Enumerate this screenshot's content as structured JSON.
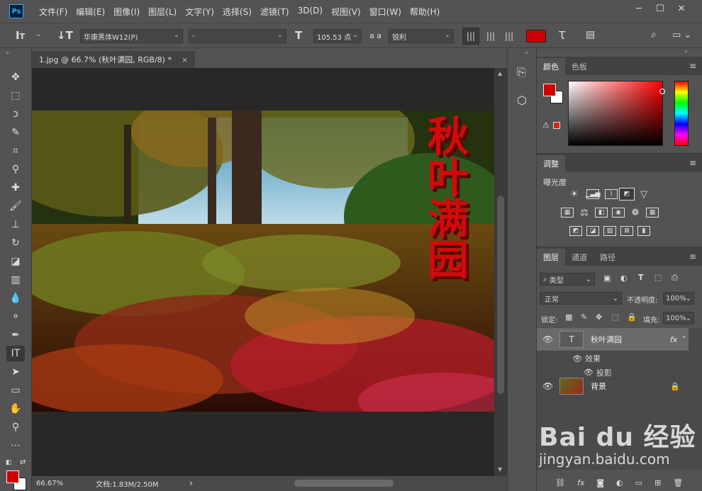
{
  "app": {
    "logo": "Ps",
    "window_controls": [
      "─",
      "☐",
      "✕"
    ]
  },
  "menu": [
    "文件(F)",
    "编辑(E)",
    "图像(I)",
    "图层(L)",
    "文字(Y)",
    "选择(S)",
    "滤镜(T)",
    "3D(D)",
    "视图(V)",
    "窗口(W)",
    "帮助(H)"
  ],
  "options": {
    "font_family": "华康黑体W12(P)",
    "font_style": "-",
    "font_size": "105.53 点",
    "aa_label": "a a",
    "antialias": "锐利",
    "text_color": "#cc0000"
  },
  "document": {
    "tab_title": "1.jpg @ 66.7% (秋叶满园, RGB/8) *",
    "close": "×",
    "image_text": "秋叶满园"
  },
  "status": {
    "zoom": "66.67%",
    "doc_info": "文档:1.83M/2.50M",
    "arrow": "›"
  },
  "color_panel": {
    "tabs": [
      "颜色",
      "色板"
    ],
    "fg": "#cc0000",
    "bg": "#ffffff"
  },
  "adjust_panel": {
    "tab": "调整",
    "subtitle": "曝光度"
  },
  "layers_panel": {
    "tabs": [
      "图层",
      "通道",
      "路径"
    ],
    "filter_label": "类型",
    "blend_mode": "正常",
    "opacity_label": "不透明度:",
    "opacity_value": "100%",
    "lock_label": "锁定:",
    "fill_label": "填充:",
    "fill_value": "100%",
    "layers": [
      {
        "name": "秋叶满园",
        "fx": "fx",
        "effects_label": "效果",
        "effect": "投影"
      },
      {
        "name": "背景"
      }
    ]
  },
  "watermark": {
    "brand": "Bai du 经验",
    "url": "jingyan.baidu.com"
  }
}
